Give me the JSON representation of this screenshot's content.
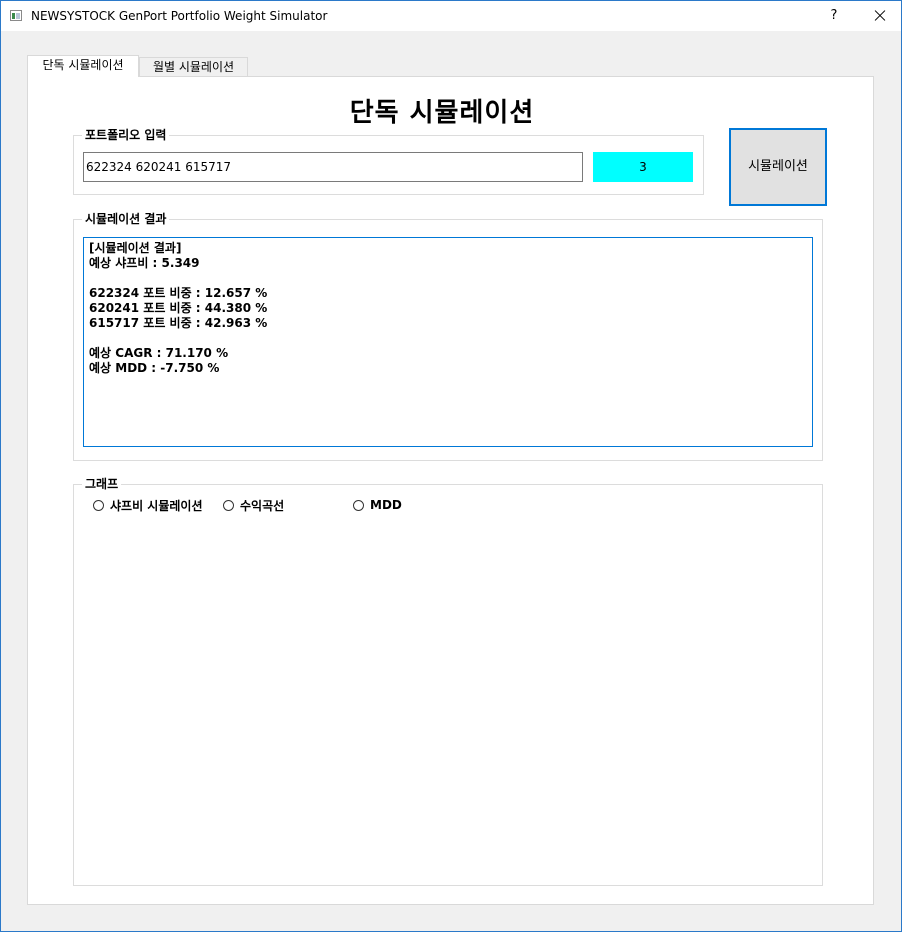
{
  "window": {
    "title": "NEWSYSTOCK GenPort Portfolio Weight Simulator",
    "help": "?"
  },
  "tabs": [
    {
      "label": "단독 시뮬레이션"
    },
    {
      "label": "월별 시뮬레이션"
    }
  ],
  "main": {
    "title": "단독 시뮬레이션",
    "portfolio": {
      "label": "포트폴리오 입력",
      "value": "622324 620241 615717",
      "count": "3"
    },
    "simulate_button": "시뮬레이션",
    "result": {
      "label": "시뮬레이션 결과",
      "lines": [
        "[시뮬레이션 결과]",
        "예상 샤프비 : 5.349",
        "",
        "622324 포트 비중 : 12.657 %",
        "620241 포트 비중 : 44.380 %",
        "615717 포트 비중 : 42.963 %",
        "",
        "예상 CAGR : 71.170 %",
        "예상 MDD : -7.750 %"
      ]
    },
    "graph": {
      "label": "그래프",
      "options": [
        "샤프비 시뮬레이션",
        "수익곡선",
        "MDD"
      ]
    }
  },
  "colors": {
    "count_bg": "#00ffff",
    "accent_border": "#0078d7"
  }
}
